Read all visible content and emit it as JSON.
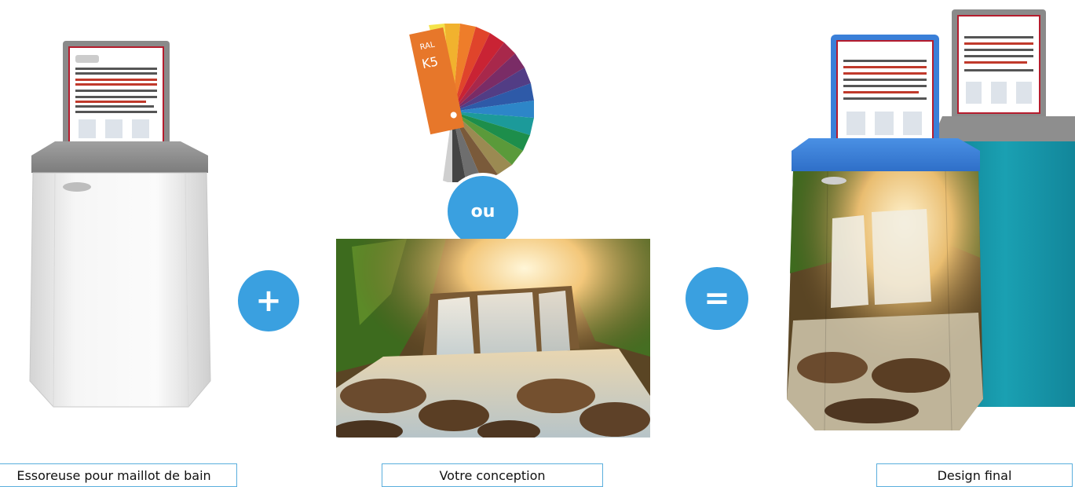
{
  "captions": {
    "left": "Essoreuse pour maillot de bain",
    "middle": "Votre conception",
    "right": "Design final"
  },
  "operators": {
    "plus": "+",
    "or": "ou",
    "equals": "="
  },
  "swatch": {
    "brand": "RAL",
    "code": "K5"
  },
  "colors": {
    "accent": "#3aa0e0",
    "machine_body": "#eeeeee",
    "lid_gray": "#8b8b8b",
    "lid_blue": "#3a7fd8",
    "teal_body": "#1a96a8"
  }
}
